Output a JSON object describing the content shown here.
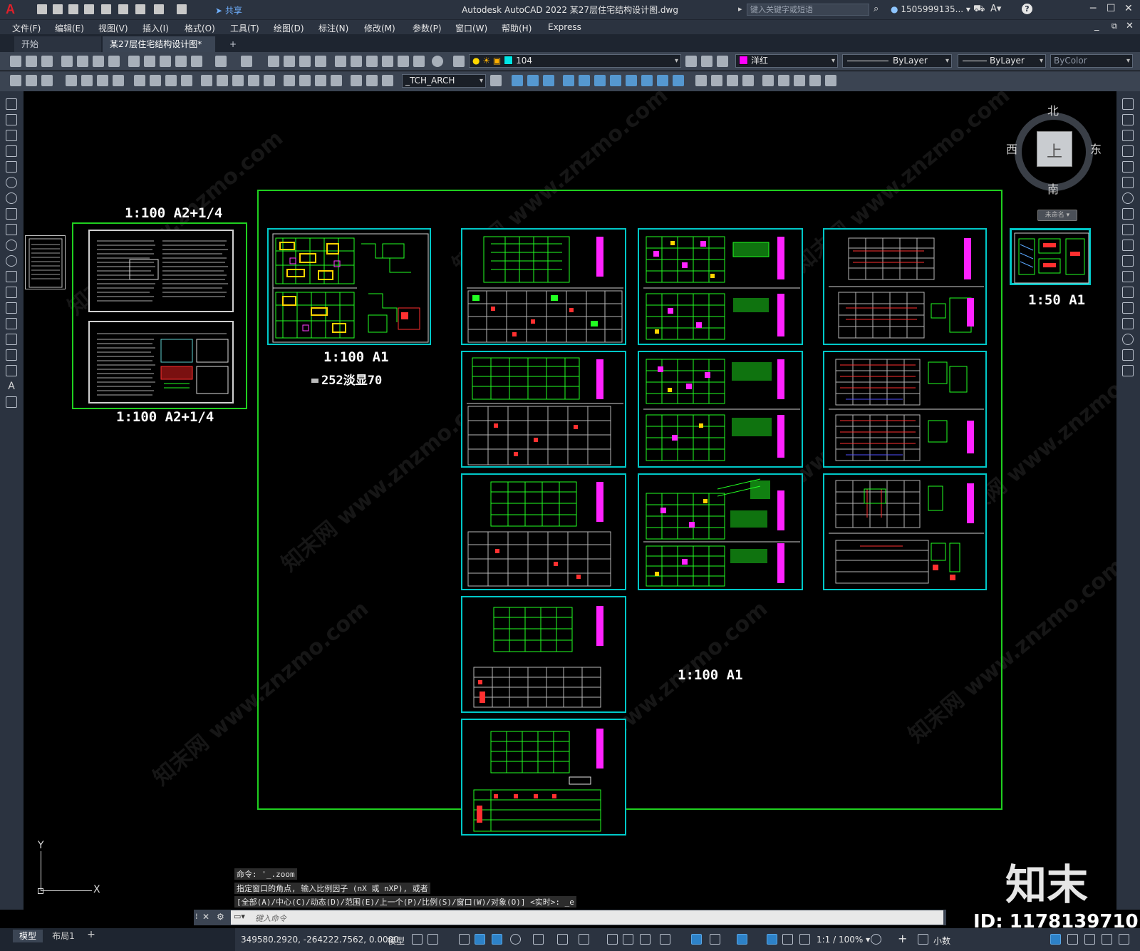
{
  "app": {
    "title": "Autodesk AutoCAD 2022    某27层住宅结构设计图.dwg",
    "share_label": "共享",
    "search_placeholder": "键入关键字或短语",
    "user": "1505999135... ▾",
    "help": "?"
  },
  "menu": [
    "文件(F)",
    "编辑(E)",
    "视图(V)",
    "插入(I)",
    "格式(O)",
    "工具(T)",
    "绘图(D)",
    "标注(N)",
    "修改(M)",
    "参数(P)",
    "窗口(W)",
    "帮助(H)",
    "Express"
  ],
  "tabs": [
    {
      "label": "开始"
    },
    {
      "label": "某27层住宅结构设计图*",
      "close": "✕"
    },
    {
      "label": "+"
    }
  ],
  "properties": {
    "layer_value": "104",
    "layer_color": "#00e6e6",
    "color_value": "洋红",
    "color_swatch": "#ff00ff",
    "linetype_value": "ByLayer",
    "lineweight_value": "ByLayer",
    "plotstyle_value": "ByColor",
    "textstyle_value": "_TCH_ARCH"
  },
  "viewcube": {
    "north": "北",
    "south": "南",
    "east": "东",
    "west": "西",
    "top": "上",
    "wcs": "未命名 ▾"
  },
  "drawing_labels": {
    "left_top_scale": "1:100  A2+1/4",
    "left_bottom_scale": "1:100  A2+1/4",
    "first_sheet_scale": "1:100  A1",
    "first_sheet_note": "252淡显70",
    "main_scale": "1:100  A1",
    "right_sheet_scale": "1:50  A1"
  },
  "ucs": {
    "x": "X",
    "y": "Y"
  },
  "command": {
    "history": [
      "命令: '_.zoom",
      "指定窗口的角点, 输入比例因子 (nX 或 nXP), 或者",
      "[全部(A)/中心(C)/动态(D)/范围(E)/上一个(P)/比例(S)/窗口(W)/对象(O)] <实时>: _e"
    ],
    "input_placeholder": "键入命令"
  },
  "layout_tabs": [
    "模型",
    "布局1",
    "+"
  ],
  "status": {
    "coords": "349580.2920, -264222.7562, 0.0000",
    "mode": "模型",
    "scale": "1:1 / 100% ▾",
    "units": "小数"
  },
  "watermark": {
    "brand": "知末",
    "id": "ID: 1178139710",
    "site": "知末网 www.znzmo.com"
  },
  "colors": {
    "accent_green": "#1fcf1f",
    "sheet_cyan": "#00c8c8",
    "drawing_green": "#22ff22",
    "drawing_magenta": "#ff22ff"
  }
}
